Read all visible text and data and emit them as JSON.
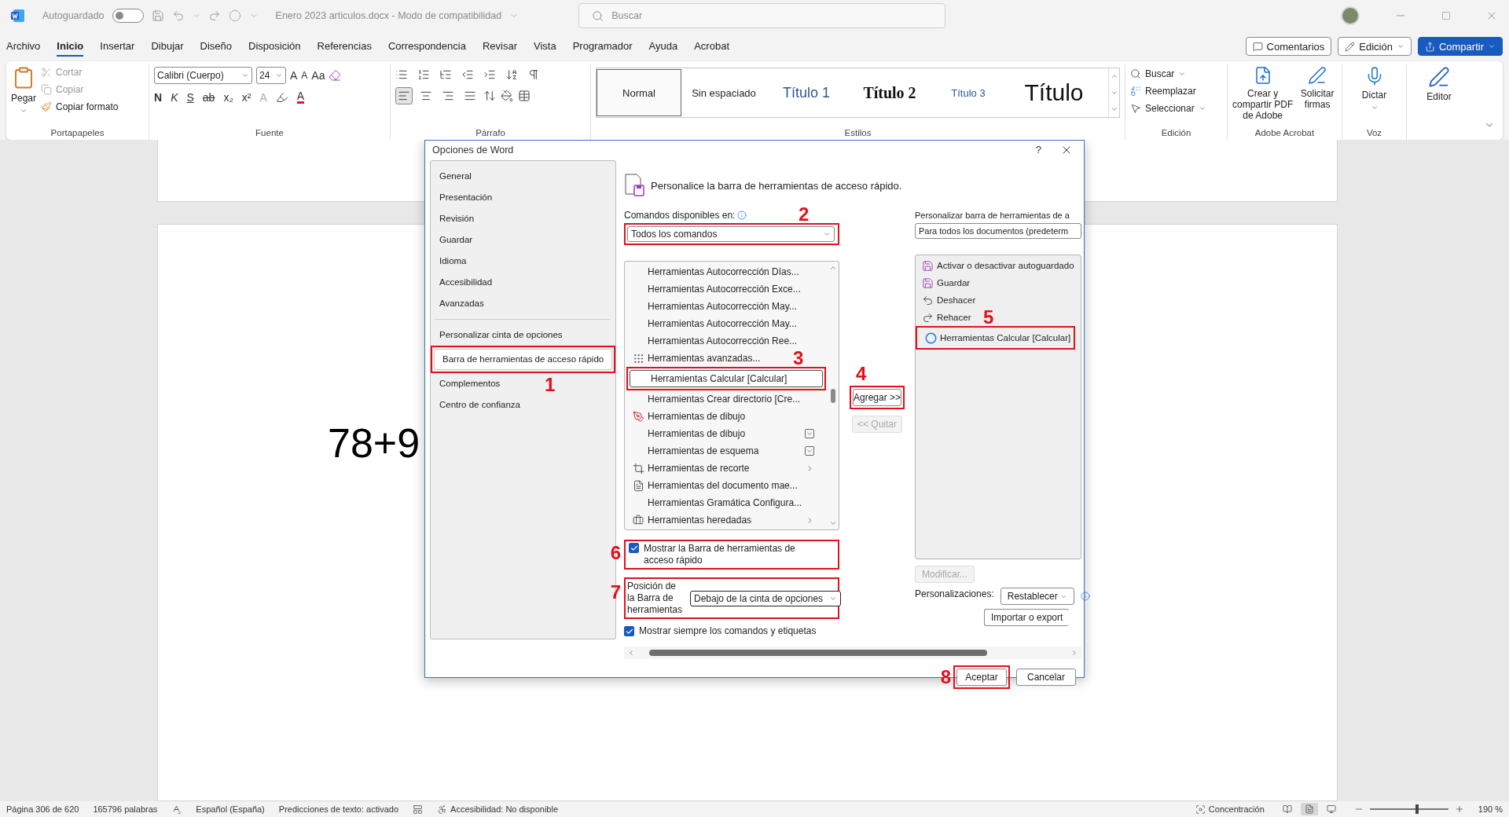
{
  "title_bar": {
    "autosave_label": "Autoguardado",
    "autosave_on": false,
    "document_title": "Enero 2023 articulos.docx  -  Modo de compatibilidad",
    "search_placeholder": "Buscar"
  },
  "menu_tabs": [
    {
      "label": "Archivo",
      "selected": false
    },
    {
      "label": "Inicio",
      "selected": true
    },
    {
      "label": "Insertar",
      "selected": false
    },
    {
      "label": "Dibujar",
      "selected": false
    },
    {
      "label": "Diseño",
      "selected": false
    },
    {
      "label": "Disposición",
      "selected": false
    },
    {
      "label": "Referencias",
      "selected": false
    },
    {
      "label": "Correspondencia",
      "selected": false
    },
    {
      "label": "Revisar",
      "selected": false
    },
    {
      "label": "Vista",
      "selected": false
    },
    {
      "label": "Programador",
      "selected": false
    },
    {
      "label": "Ayuda",
      "selected": false
    },
    {
      "label": "Acrobat",
      "selected": false
    }
  ],
  "top_buttons": {
    "comments": "Comentarios",
    "editing": "Edición",
    "share": "Compartir"
  },
  "ribbon": {
    "clipboard": {
      "paste": "Pegar",
      "cut": "Cortar",
      "copy": "Copiar",
      "format_painter": "Copiar formato",
      "group": "Portapapeles"
    },
    "font": {
      "font_name": "Calibri (Cuerpo)",
      "font_size": "24",
      "grow": "A",
      "shrink": "A",
      "case": "Aa",
      "bold": "N",
      "italic": "K",
      "underline": "S",
      "strike": "ab",
      "subscript": "x₂",
      "superscript": "x²",
      "effects": "A",
      "font_color_label": "A",
      "group": "Fuente"
    },
    "paragraph": {
      "alignments": [
        {
          "selected": true
        },
        {
          "selected": false
        },
        {
          "selected": false
        },
        {
          "selected": false
        }
      ],
      "group": "Párrafo"
    },
    "styles": {
      "items": [
        {
          "label": "Normal",
          "kind": "normal",
          "selected": true
        },
        {
          "label": "Sin espaciado",
          "kind": "nospace",
          "selected": false
        },
        {
          "label": "Título 1",
          "kind": "h1",
          "selected": false
        },
        {
          "label": "Título 2",
          "kind": "h2",
          "selected": false
        },
        {
          "label": "Título 3",
          "kind": "h3",
          "selected": false
        },
        {
          "label": "Título",
          "kind": "title",
          "selected": false
        }
      ],
      "group": "Estilos"
    },
    "editing": {
      "find": "Buscar",
      "replace": "Reemplazar",
      "select": "Seleccionar",
      "group": "Edición"
    },
    "acrobat": {
      "create_pdf": "Crear y compartir PDF de Adobe",
      "signatures": "Solicitar firmas",
      "group": "Adobe Acrobat"
    },
    "voice": {
      "dictate": "Dictar",
      "group": "Voz"
    },
    "editor": {
      "label": "Editor"
    }
  },
  "document": {
    "text": "78+9"
  },
  "dialog": {
    "title": "Opciones de Word",
    "help": "?",
    "nav_sections": [
      {
        "items": [
          {
            "label": "General",
            "selected": false
          },
          {
            "label": "Presentación",
            "selected": false
          },
          {
            "label": "Revisión",
            "selected": false
          },
          {
            "label": "Guardar",
            "selected": false
          },
          {
            "label": "Idioma",
            "selected": false
          },
          {
            "label": "Accesibilidad",
            "selected": false
          },
          {
            "label": "Avanzadas",
            "selected": false
          }
        ]
      },
      {
        "items": [
          {
            "label": "Personalizar cinta de opciones",
            "selected": false
          },
          {
            "label": "Barra de herramientas de acceso rápido",
            "selected": true,
            "annotation": "1"
          },
          {
            "label": "Complementos",
            "selected": false
          },
          {
            "label": "Centro de confianza",
            "selected": false
          }
        ]
      }
    ],
    "heading": "Personalice la barra de herramientas de acceso rápido.",
    "commands_label": "Comandos disponibles en:",
    "commands_dropdown": {
      "value": "Todos los comandos",
      "annotation": "2"
    },
    "commands": [
      {
        "label": "Herramientas Autocorrección Días...",
        "kind": "plain",
        "selected": false
      },
      {
        "label": "Herramientas Autocorrección Exce...",
        "kind": "plain",
        "selected": false
      },
      {
        "label": "Herramientas Autocorrección May...",
        "kind": "plain",
        "selected": false
      },
      {
        "label": "Herramientas Autocorrección May...",
        "kind": "plain",
        "selected": false
      },
      {
        "label": "Herramientas Autocorrección Ree...",
        "kind": "plain",
        "selected": false
      },
      {
        "label": "Herramientas avanzadas...",
        "kind": "plain",
        "selected": false
      },
      {
        "label": "Herramientas Calcular [Calcular]",
        "kind": "plain",
        "selected": true,
        "annotation": "3"
      },
      {
        "label": "Herramientas Crear directorio [Cre...",
        "kind": "plain",
        "selected": false
      },
      {
        "label": "Herramientas de dibujo",
        "kind": "plain",
        "selected": false
      },
      {
        "label": "Herramientas de dibujo",
        "kind": "dropdown",
        "selected": false
      },
      {
        "label": "Herramientas de esquema",
        "kind": "dropdown",
        "selected": false
      },
      {
        "label": "Herramientas de recorte",
        "kind": "submenu",
        "selected": false
      },
      {
        "label": "Herramientas del documento mae...",
        "kind": "plain",
        "selected": false
      },
      {
        "label": "Herramientas Gramática Configura...",
        "kind": "plain",
        "selected": false
      },
      {
        "label": "Herramientas heredadas",
        "kind": "submenu",
        "selected": false
      }
    ],
    "add_button": {
      "label": "Agregar >>",
      "annotation": "4"
    },
    "remove_button": {
      "label": "<< Quitar",
      "disabled": true
    },
    "customize_label": "Personalizar barra de herramientas de a",
    "customize_dropdown": "Para todos los documentos (predeterm",
    "qat_items": [
      {
        "label": "Activar o desactivar autoguardado"
      },
      {
        "label": "Guardar"
      },
      {
        "label": "Deshacer"
      },
      {
        "label": "Rehacer"
      },
      {
        "label": "Herramientas Calcular [Calcular]",
        "annotation": "5"
      }
    ],
    "modify_button": {
      "label": "Modificar...",
      "disabled": true
    },
    "customizations_label": "Personalizaciones:",
    "reset_button": "Restablecer",
    "import_button": "Importar o export",
    "show_qat": {
      "label": "Mostrar la Barra de herramientas de acceso rápido",
      "checked": true,
      "annotation": "6"
    },
    "position": {
      "label": "Posición de la Barra de herramientas",
      "value": "Debajo de la cinta de opciones",
      "annotation": "7"
    },
    "show_labels": {
      "label": "Mostrar siempre los comandos y etiquetas",
      "checked": true
    },
    "ok_button": {
      "label": "Aceptar",
      "annotation": "8"
    },
    "cancel_button": "Cancelar"
  },
  "status_bar": {
    "page": "Página 306 de 620",
    "words": "165796 palabras",
    "language": "Español (España)",
    "predictions": "Predicciones de texto: activado",
    "accessibility": "Accesibilidad: No disponible",
    "focus": "Concentración",
    "views": [
      {
        "selected": false
      },
      {
        "selected": true
      },
      {
        "selected": false
      }
    ],
    "zoom_slider": {
      "level": 0.6
    },
    "zoom": "190 %"
  }
}
